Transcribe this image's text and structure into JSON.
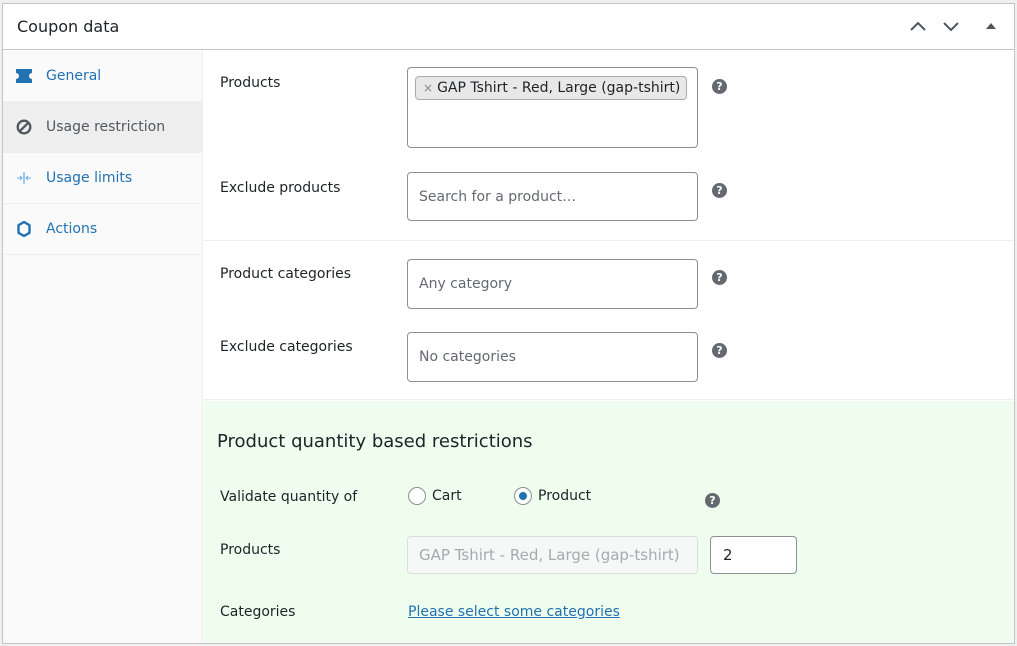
{
  "panel": {
    "title": "Coupon data",
    "controls": {
      "move_up": "chevron-up-icon",
      "move_down": "chevron-down-icon",
      "toggle": "triangle-up-icon"
    }
  },
  "sidebar": {
    "items": [
      {
        "label": "General",
        "icon": "ticket-icon",
        "active": false
      },
      {
        "label": "Usage restriction",
        "icon": "block-icon",
        "active": true
      },
      {
        "label": "Usage limits",
        "icon": "limits-icon",
        "active": false
      },
      {
        "label": "Actions",
        "icon": "gear-icon",
        "active": false
      }
    ]
  },
  "fields": {
    "products": {
      "label": "Products",
      "selected": "GAP Tshirt - Red, Large (gap-tshirt)",
      "remove_glyph": "×"
    },
    "exclude_products": {
      "label": "Exclude products",
      "placeholder": "Search for a product…"
    },
    "product_categories": {
      "label": "Product categories",
      "placeholder": "Any category"
    },
    "exclude_categories": {
      "label": "Exclude categories",
      "placeholder": "No categories"
    },
    "help_glyph": "?"
  },
  "quantity_restrictions": {
    "heading": "Product quantity based restrictions",
    "validate_label": "Validate quantity of",
    "options": [
      {
        "label": "Cart",
        "checked": false
      },
      {
        "label": "Product",
        "checked": true
      }
    ],
    "products_label": "Products",
    "product_name": "GAP Tshirt - Red, Large (gap-tshirt)",
    "product_qty": "2",
    "categories_label": "Categories",
    "categories_link": "Please select some categories"
  },
  "colors": {
    "accent": "#2271b1",
    "section_bg": "#effdef",
    "help_icon": "#646970"
  }
}
